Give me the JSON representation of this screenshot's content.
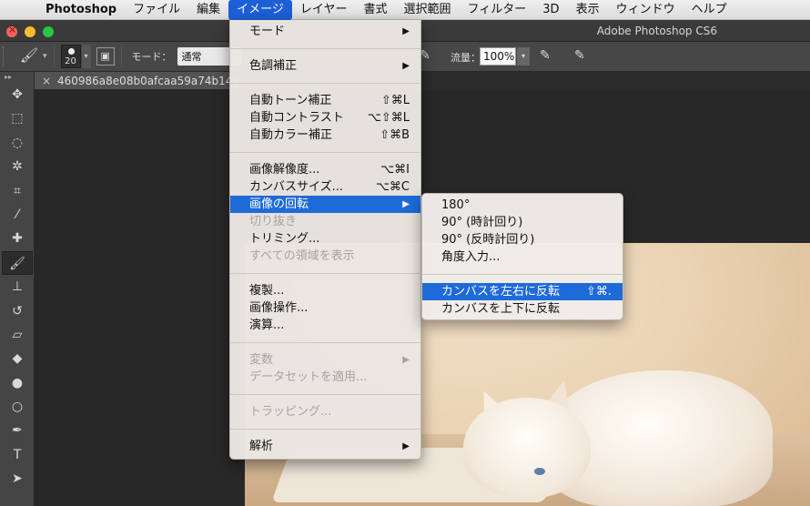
{
  "menubar": {
    "apple": "",
    "items": [
      "Photoshop",
      "ファイル",
      "編集",
      "イメージ",
      "レイヤー",
      "書式",
      "選択範囲",
      "フィルター",
      "3D",
      "表示",
      "ウィンドウ",
      "ヘルプ"
    ],
    "active_index": 3
  },
  "window": {
    "title": "Adobe Photoshop CS6"
  },
  "options_bar": {
    "brush_size": "20",
    "mode_label": "モード：",
    "mode_value": "通常",
    "flow_label": "流量：",
    "flow_value": "100%"
  },
  "document": {
    "tab_title": "460986a8e08b0afcaa59a74b149"
  },
  "tools": [
    "move-icon",
    "marquee-icon",
    "lasso-icon",
    "magic-wand-icon",
    "crop-icon",
    "eyedropper-icon",
    "healing-icon",
    "brush-icon",
    "stamp-icon",
    "history-brush-icon",
    "eraser-icon",
    "paint-bucket-icon",
    "blur-icon",
    "dodge-icon",
    "pen-icon",
    "type-icon",
    "path-select-icon"
  ],
  "image_menu": {
    "mode": "モード",
    "adjustments": "色調補正",
    "auto_tone": "自動トーン補正",
    "auto_tone_sc": "⇧⌘L",
    "auto_contrast": "自動コントラスト",
    "auto_contrast_sc": "⌥⇧⌘L",
    "auto_color": "自動カラー補正",
    "auto_color_sc": "⇧⌘B",
    "image_size": "画像解像度...",
    "image_size_sc": "⌥⌘I",
    "canvas_size": "カンバスサイズ...",
    "canvas_size_sc": "⌥⌘C",
    "rotation": "画像の回転",
    "crop": "切り抜き",
    "trim": "トリミング...",
    "reveal_all": "すべての領域を表示",
    "duplicate": "複製...",
    "apply_image": "画像操作...",
    "calculations": "演算...",
    "variables": "変数",
    "apply_data_set": "データセットを適用...",
    "trap": "トラッピング...",
    "analysis": "解析"
  },
  "rotation_menu": {
    "r180": "180°",
    "r90cw": "90° (時計回り)",
    "r90ccw": "90° (反時計回り)",
    "arbitrary": "角度入力...",
    "flip_h": "カンバスを左右に反転",
    "flip_h_sc": "⇧⌘.",
    "flip_v": "カンバスを上下に反転"
  }
}
